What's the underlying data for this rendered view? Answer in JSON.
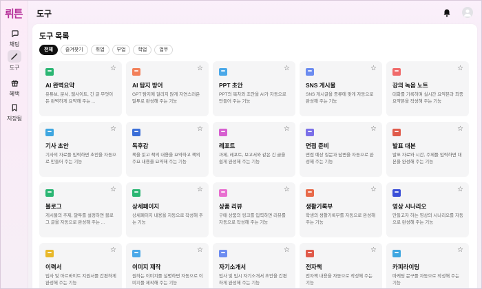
{
  "app": {
    "logo": "뤼튼"
  },
  "sidebar": {
    "items": [
      {
        "label": "채팅",
        "icon": "chat-bubble-icon"
      },
      {
        "label": "도구",
        "icon": "magic-wand-icon",
        "active": true
      },
      {
        "label": "혜택",
        "icon": "gift-icon"
      },
      {
        "label": "저장됨",
        "icon": "bookmark-icon"
      }
    ]
  },
  "header": {
    "title": "도구"
  },
  "main": {
    "section_title": "도구 목록",
    "filters": [
      "전체",
      "즐겨찾기",
      "취업",
      "부업",
      "학업",
      "업무"
    ],
    "active_filter": "전체",
    "tools": [
      {
        "name": "AI 완벽요약",
        "desc": "유튜브, 문서, 웹사이트, 긴 글 무엇이든 완벽하게 요약해 주는 ...",
        "color": "#2bb673"
      },
      {
        "name": "AI 탐지 방어",
        "desc": "GPT 탐지에 걸리지 않게 자연스러운 말투로 완성해 주는 기능",
        "color": "#f2805a"
      },
      {
        "name": "PPT 초안",
        "desc": "PPT의 목차와 초안을 AI가 자동으로 만들어 주는 기능",
        "color": "#4aa8e8"
      },
      {
        "name": "SNS 게시물",
        "desc": "SNS 게시글을 종류에 맞게 자동으로 완성해 주는 기능",
        "color": "#6c8cf0"
      },
      {
        "name": "강의 녹음 노트",
        "desc": "대화를 기록하며 실시간 요약본과 최종 요약본을 작성해 주는 기능",
        "color": "#f06a6a"
      },
      {
        "name": "기사 초안",
        "desc": "기사의 자료를 입력하면 초안을 자동으로 만들어 주는 기능",
        "color": "#3ea6e0"
      },
      {
        "name": "독후감",
        "desc": "책을 읽고 책의 내용을 요약하고 책의 주요 내용을 요약해 주는 기능",
        "color": "#3b6fd8"
      },
      {
        "name": "레포트",
        "desc": "과제, 레포트, 보고서와 같은 긴 글을 쉽게 완성해 주는 기능",
        "color": "#d65fd0"
      },
      {
        "name": "면접 준비",
        "desc": "면접 예상 질문과 답변을 자동으로 완성해 주는 기능",
        "color": "#7a6fe8"
      },
      {
        "name": "발표 대본",
        "desc": "발표 자료와 시간, 주제를 입력하면 대본을 완성해 주는 기능",
        "color": "#e05a4a"
      },
      {
        "name": "블로그",
        "desc": "게시물의 주제, 말투를 설정하면 블로그 글을 자동으로 완성해 주는 ...",
        "color": "#2bb673"
      },
      {
        "name": "상세페이지",
        "desc": "상세페이지 내용을 자동으로 작성해 주는 기능",
        "color": "#2bb673"
      },
      {
        "name": "상품 리뷰",
        "desc": "구매 상품의 링크를 입력하면 리뷰를 자동으로 작성해 주는 기능",
        "color": "#e86fd0"
      },
      {
        "name": "생활기록부",
        "desc": "학생의 생활기록부를 자동으로 완성해 주는 기능",
        "color": "#e86a4a"
      },
      {
        "name": "영상 시나리오",
        "desc": "만들고자 하는 영상의 시나리오를 자동으로 완성해 주는 기능",
        "color": "#3b4fd8"
      },
      {
        "name": "이력서",
        "desc": "입사 및 아르바이트 지원서를 간편하게 완성해 주는 기능",
        "color": "#e8b82a"
      },
      {
        "name": "이미지 제작",
        "desc": "원하는 이미지를 설명하면 자동으로 이미지를 제작해 주는 기능",
        "color": "#4aa8e8"
      },
      {
        "name": "자기소개서",
        "desc": "입사 및 입시 자기소개서 초안을 간편하게 완성해 주는 기능",
        "color": "#6c8cf0"
      },
      {
        "name": "전자책",
        "desc": "전자책 내용을 자동으로 작성해 주는 기능",
        "color": "#e05a4a"
      },
      {
        "name": "카피라이팅",
        "desc": "마케팅 문구를 자동으로 작성해 주는 기능",
        "color": "#3ea6e0"
      }
    ]
  }
}
